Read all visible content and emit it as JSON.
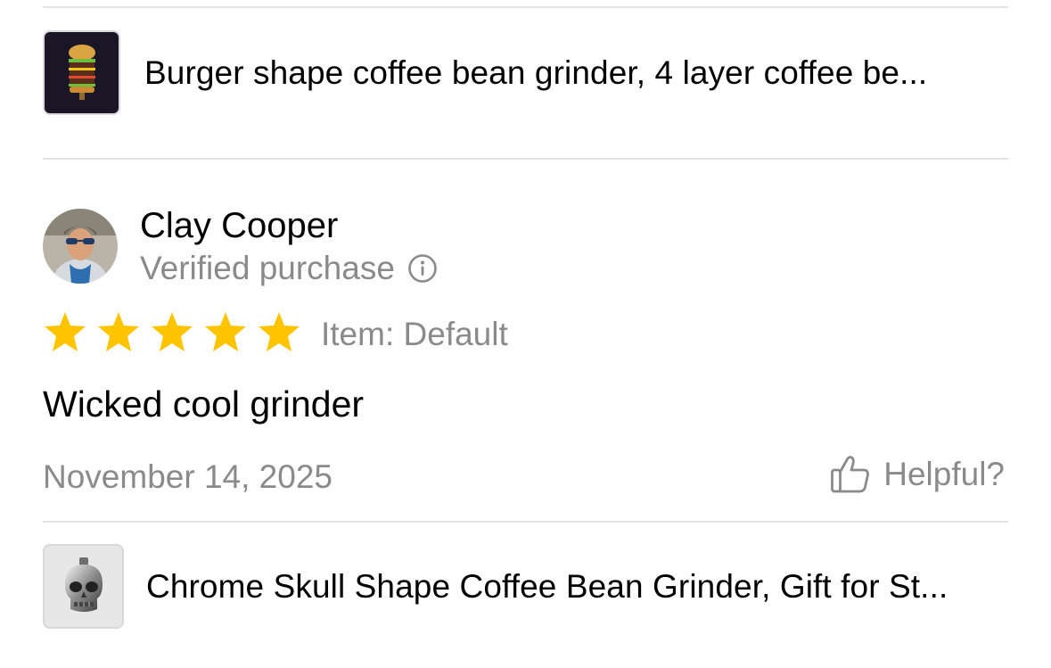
{
  "products": [
    {
      "title": "Burger shape coffee bean grinder, 4 layer coffee be...",
      "thumbnail_icon": "burger-grinder-image"
    },
    {
      "title": "Chrome Skull Shape Coffee Bean Grinder, Gift for St...",
      "thumbnail_icon": "skull-grinder-image"
    }
  ],
  "review": {
    "reviewer_name": "Clay Cooper",
    "verified_label": "Verified purchase",
    "rating": 5,
    "rating_max": 5,
    "item_variant": "Item: Default",
    "text": "Wicked cool grinder",
    "date": "November 14, 2025",
    "helpful_label": "Helpful?"
  },
  "colors": {
    "star": "#FFC400",
    "secondary_text": "#8A8A8A",
    "divider": "#E2E2E2"
  }
}
